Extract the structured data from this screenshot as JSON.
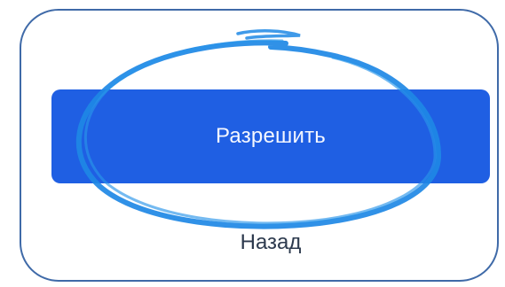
{
  "dialog": {
    "allow_label": "Разрешить",
    "back_label": "Назад"
  },
  "annotation": {
    "kind": "hand-drawn-circle",
    "color": "#1e88e5"
  },
  "colors": {
    "button_fill": "#1f5fe3",
    "card_border": "#3f6aa8"
  }
}
